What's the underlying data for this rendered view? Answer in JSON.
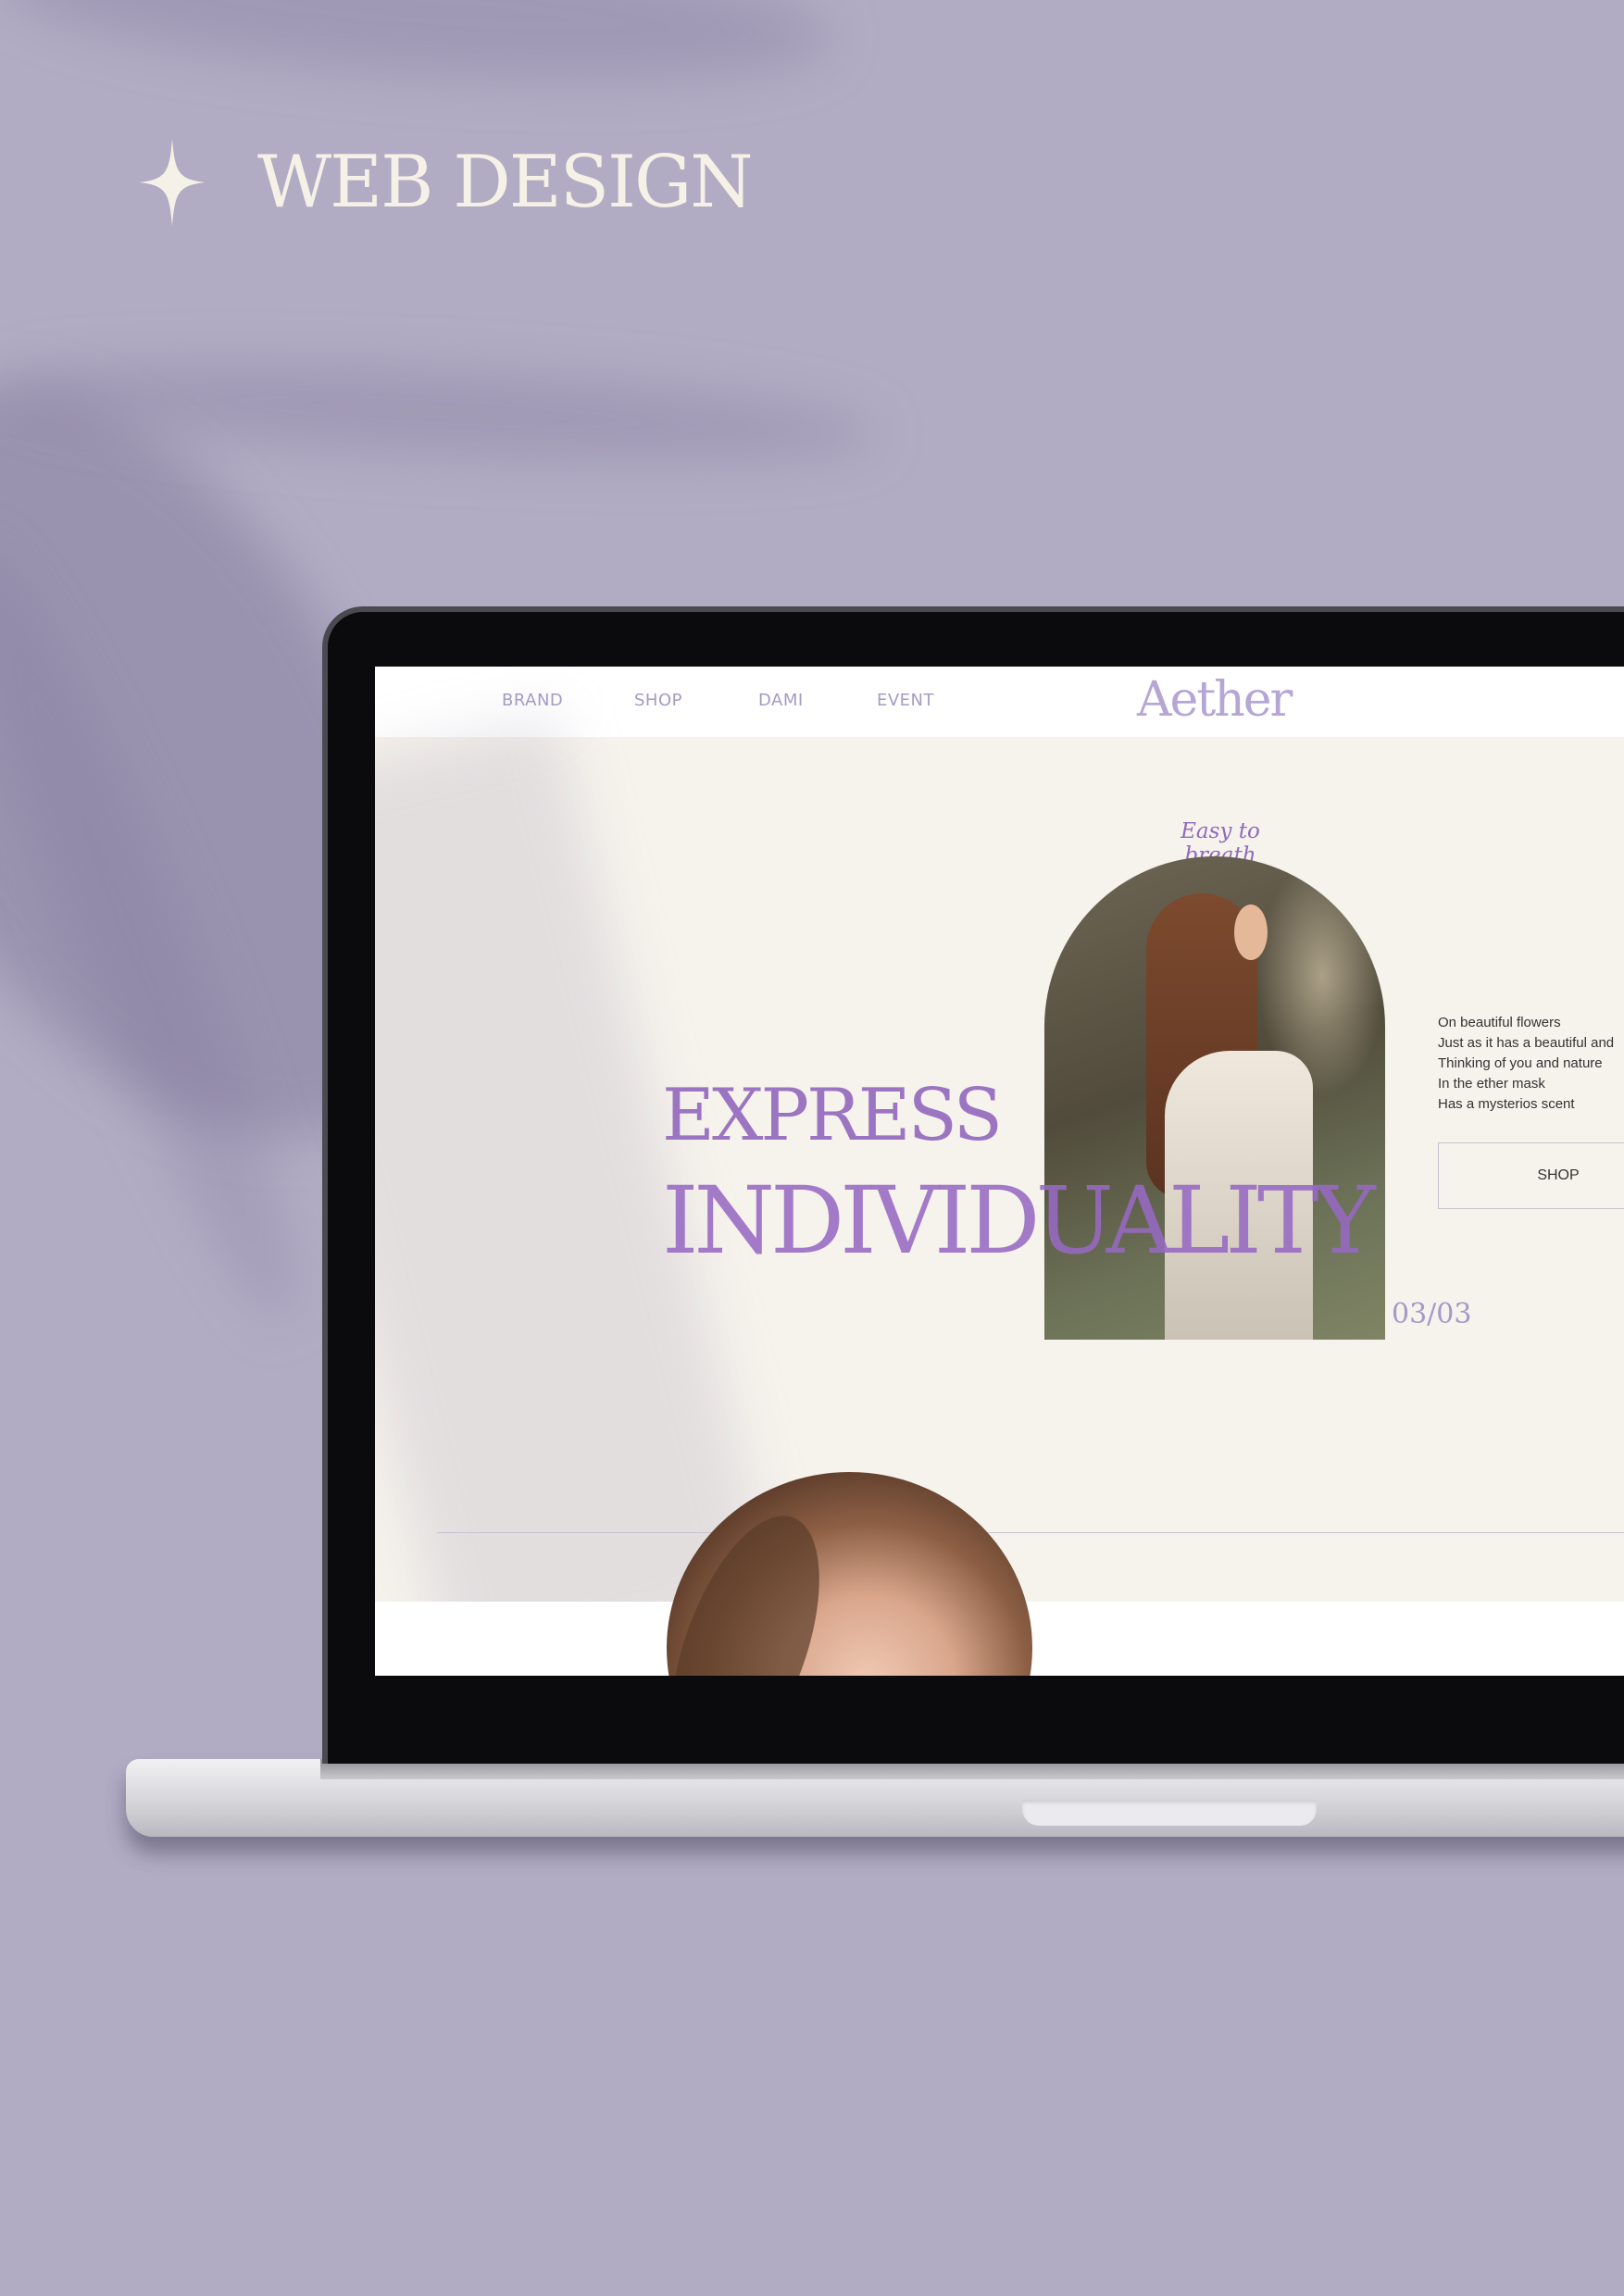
{
  "heading": {
    "title": "WEB DESIGN",
    "icon": "four-point-star-icon"
  },
  "site": {
    "nav": [
      "BRAND",
      "SHOP",
      "DAMI",
      "EVENT"
    ],
    "logo": "Aether",
    "hero": {
      "caption": "Easy to breath",
      "line1": "EXPRESS",
      "line2": "INDIVIDUALITY",
      "counter": "03/03",
      "poem": [
        "On beautiful flowers",
        "Just as it has a beautiful and",
        "Thinking of you and nature",
        "In the ether mask",
        "Has a mysterios scent"
      ],
      "button": "SHOP"
    }
  },
  "colors": {
    "background": "#b1acc4",
    "accent_purple": "#9b74c2",
    "heading_cream": "#f6f1e6",
    "screen_bg": "#f6f2ec"
  }
}
